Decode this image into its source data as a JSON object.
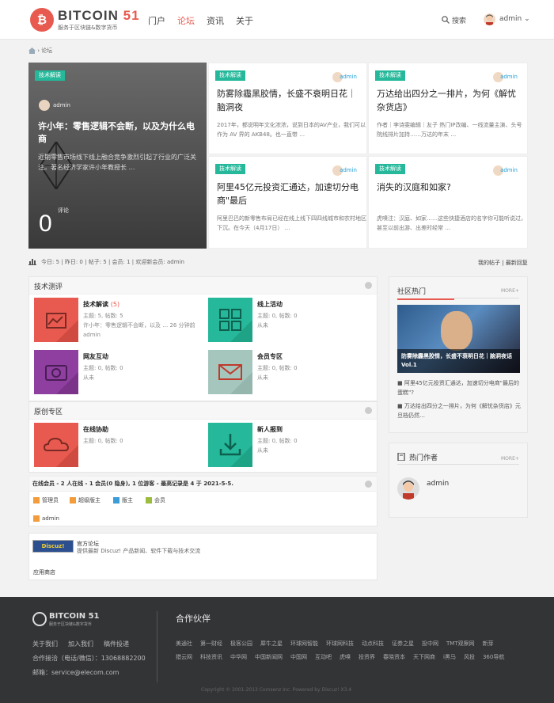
{
  "header": {
    "brand": "BITCOIN",
    "brand_num": "51",
    "brand_sub": "服务于区块链&数字货币",
    "nav": [
      "门户",
      "论坛",
      "资讯",
      "关于"
    ],
    "search": "搜索",
    "user": "admin"
  },
  "breadcrumb": {
    "current": "论坛"
  },
  "hero": {
    "tag": "技术解读",
    "author": "admin",
    "title": "许小年：零售逻辑不会断，以及为什么电商",
    "excerpt": "近期零售市场线下线上融合竞争激烈引起了行业的广泛关注。著名经济学家许小年教授长 …",
    "number": "0",
    "number_label": "评论"
  },
  "cards": [
    {
      "tag": "技术解读",
      "author": "admin",
      "title": "防雾除霾黑胶情，长盛不衰明日花｜脑洞夜",
      "excerpt": "2017年，都说明年文化浓浓，说到日本的AV产业，我们可以作为 AV 界的 AKB48。也一直带 …"
    },
    {
      "tag": "技术解读",
      "author": "admin",
      "title": "万达给出四分之一排片，为何《解忧杂货店》",
      "excerpt": "作者｜李诗雯编辑｜友子 热门IP改编、一线流量主演、头号院线排片加持……万达的年末 …"
    },
    {
      "tag": "技术解读",
      "author": "admin",
      "title": "阿里45亿元投资汇通达，加速切分电商\"最后",
      "excerpt": "阿里巴巴的新零售布局已经在线上线下四四线城市和农村地区下沉。在今天（4月17日） …"
    },
    {
      "tag": "技术解读",
      "author": "admin",
      "title": "消失的汉庭和如家?",
      "excerpt": "虎嗅注：汉庭、如家……这些快捷酒店的名字你可能听说过，甚至以前出游、出差时经常 …"
    }
  ],
  "stats": {
    "text": "今日: 5 | 昨日: 0 | 帖子: 5 | 会员: 1 | 欢迎新会员: admin",
    "links": [
      "我的帖子",
      "最新回复"
    ]
  },
  "sections": [
    {
      "title": "技术测评",
      "forums": [
        {
          "name": "技术解读",
          "count": "(5)",
          "meta1": "主题: 5, 帖数: 5",
          "meta2": "许小年：零售逻辑不会断，以及 … 26 分钟前 admin"
        },
        {
          "name": "线上活动",
          "count": "",
          "meta1": "主题: 0, 帖数: 0",
          "meta2": "从未"
        },
        {
          "name": "网友互动",
          "count": "",
          "meta1": "主题: 0, 帖数: 0",
          "meta2": "从未"
        },
        {
          "name": "会员专区",
          "count": "",
          "meta1": "主题: 0, 帖数: 0",
          "meta2": "从未"
        }
      ]
    },
    {
      "title": "原创专区",
      "forums": [
        {
          "name": "在线协助",
          "count": "",
          "meta1": "主题: 0, 帖数: 0",
          "meta2": ""
        },
        {
          "name": "新人报到",
          "count": "",
          "meta1": "主题: 0, 帖数: 0",
          "meta2": "从未"
        }
      ]
    }
  ],
  "online": {
    "text": "在线会员 - 2 人在线 - 1 会员(0 隐身), 1 位游客 - 最高记录是 4 于 2021-5-5.",
    "legend": [
      "管理员",
      "超级版主",
      "版主",
      "会员"
    ],
    "member": "admin"
  },
  "official": {
    "logo": "Discuz!",
    "title": "官方论坛",
    "desc": "提供最新 Discuz! 产品新闻、软件下载与技术交流",
    "apps": "应用商店"
  },
  "side_hot": {
    "title": "社区热门",
    "more": "MORE+",
    "img_caption": "防雾除霾黑胶情，长盛不衰明日花｜脑洞夜话 Vol.1",
    "items": [
      "阿里45亿元投资汇通达，加速切分电商\"最后的蛋糕\"?",
      "万达给出四分之一排片，为何《解忧杂货店》元旦档仍然…"
    ]
  },
  "side_authors": {
    "title": "热门作者",
    "more": "MORE+",
    "author": "admin"
  },
  "footer": {
    "brand": "BITCOIN",
    "brand_num": "51",
    "brand_sub": "服务于区块链&数字货币",
    "links": [
      "关于我们",
      "加入我们",
      "稿件投递"
    ],
    "phone": "合作接洽（电话/微信）：13068882200",
    "email": "邮箱：service@elecom.com",
    "partners_title": "合作伙伴",
    "partners": [
      "美通社",
      "第一财经",
      "极客公园",
      "犀牛之星",
      "环球网智能",
      "环球网科技",
      "动点科技",
      "证券之星",
      "投中网",
      "TMT观察网",
      "新芽",
      "猎云网",
      "科技资讯",
      "中华网",
      "中国新闻网",
      "中国网",
      "互动吧",
      "虎嗅",
      "投资界",
      "春晓资本",
      "天下网商",
      "i黑马",
      "风投",
      "360导航"
    ],
    "copyright": "Copyright © 2001-2013 Comsenz Inc. Powered by Discuz! X3.4"
  },
  "colors": {
    "accent": "#e85a4f",
    "tag": "#25b89a",
    "link": "#25a0d8"
  }
}
